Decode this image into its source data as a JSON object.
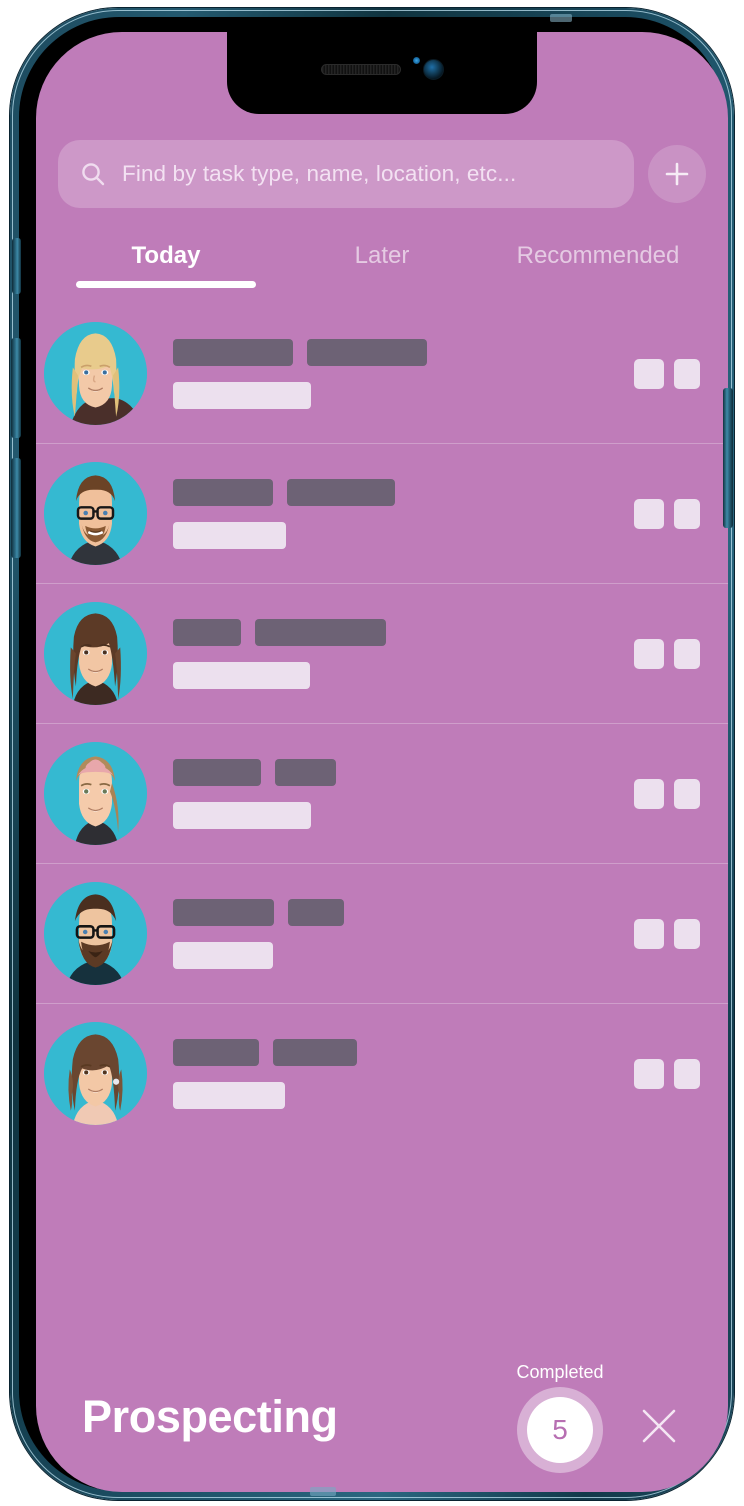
{
  "device": {
    "frame_color": "#1d4a5e",
    "notch": {
      "speaker": "speaker-grille",
      "camera": "front-camera"
    }
  },
  "theme": {
    "screen_background": "#bf7cb9",
    "accent_white": "#ffffff",
    "placeholder_dark": "#6d6275",
    "placeholder_light": "#ece0ee",
    "avatar_background": "#35b9d1",
    "count_text_color": "#b76fb2"
  },
  "search": {
    "placeholder": "Find by task type, name, location, etc...",
    "icon": "search-icon",
    "add_icon": "plus-icon"
  },
  "tabs": [
    {
      "label": "Today",
      "active": true
    },
    {
      "label": "Later",
      "active": false
    },
    {
      "label": "Recommended",
      "active": false
    }
  ],
  "task_list": [
    {
      "avatar": "blonde-woman-avatar",
      "bars_top": [
        120,
        120
      ],
      "bar_bottom": 138,
      "actions": [
        30,
        26
      ]
    },
    {
      "avatar": "bearded-man-glasses-avatar",
      "bars_top": [
        100,
        108
      ],
      "bar_bottom": 113,
      "actions": [
        30,
        26
      ]
    },
    {
      "avatar": "brunette-woman-avatar",
      "bars_top": [
        68,
        131
      ],
      "bar_bottom": 137,
      "actions": [
        30,
        26
      ]
    },
    {
      "avatar": "headband-woman-avatar",
      "bars_top": [
        88,
        61
      ],
      "bar_bottom": 138,
      "actions": [
        30,
        26
      ]
    },
    {
      "avatar": "bearded-man-dark-avatar",
      "bars_top": [
        101,
        56
      ],
      "bar_bottom": 100,
      "actions": [
        30,
        26
      ]
    },
    {
      "avatar": "wavy-hair-woman-avatar",
      "bars_top": [
        86,
        84
      ],
      "bar_bottom": 112,
      "actions": [
        30,
        26
      ]
    }
  ],
  "bottom_bar": {
    "title": "Prospecting",
    "completed_label": "Completed",
    "completed_count": "5",
    "close_icon": "close-icon"
  }
}
